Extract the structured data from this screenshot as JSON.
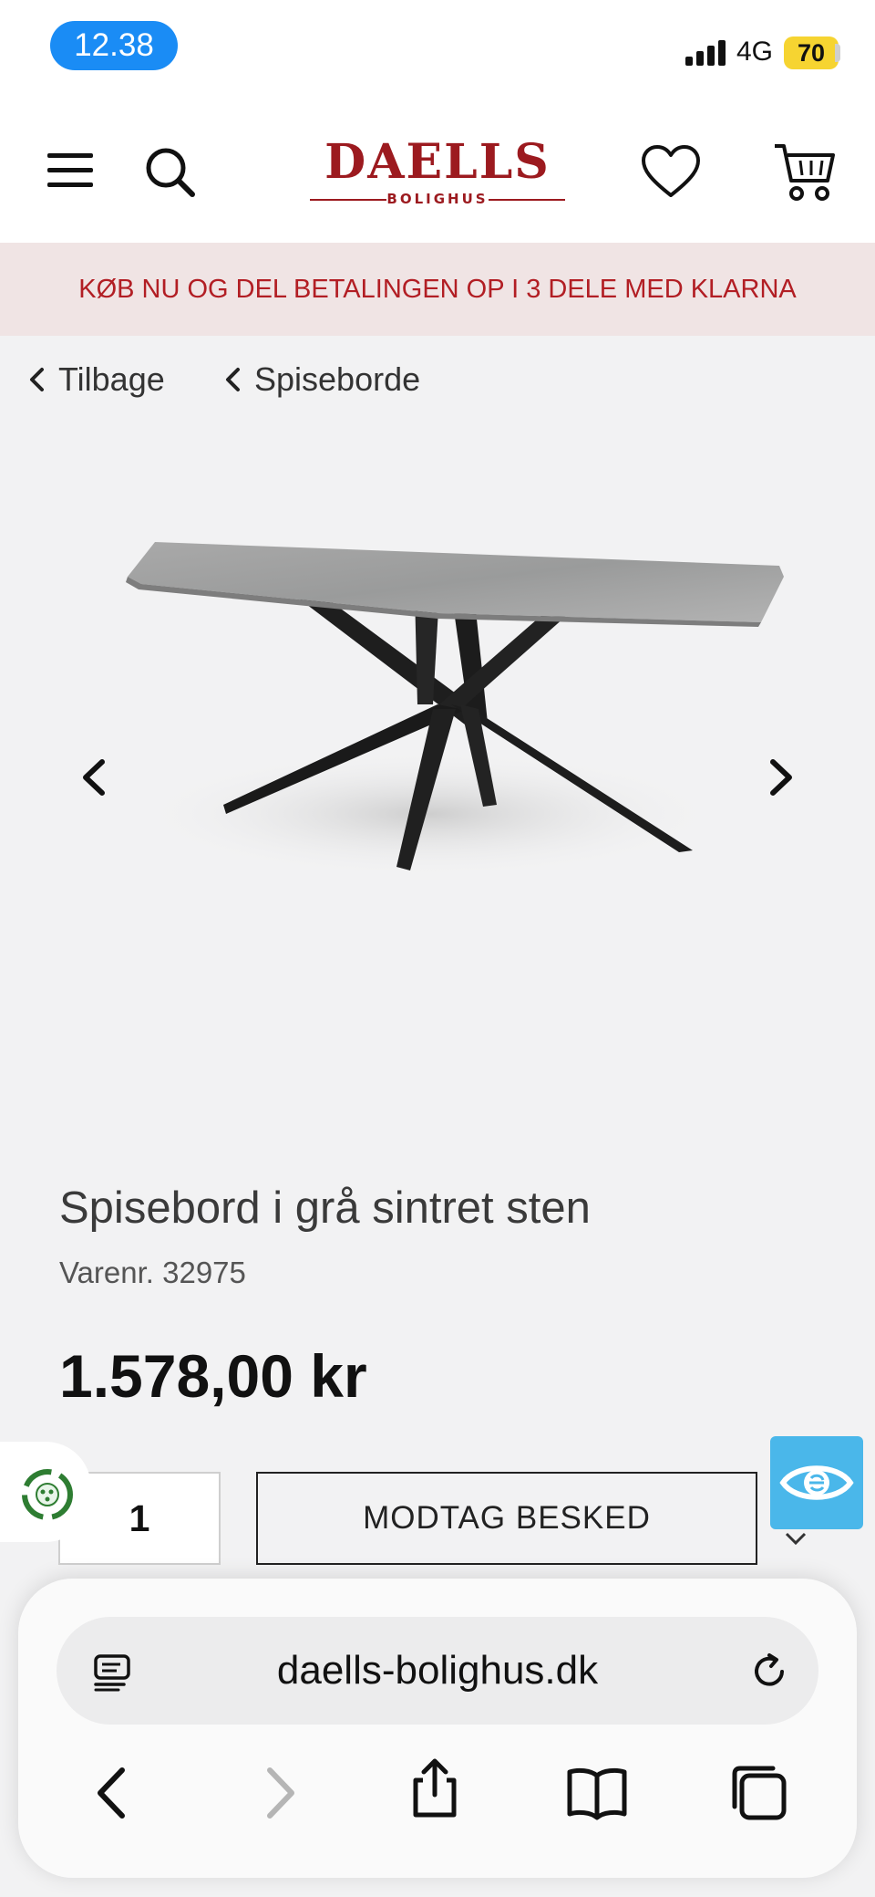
{
  "status_bar": {
    "time": "12.38",
    "network": "4G",
    "battery": "70"
  },
  "header": {
    "logo_main": "DAELLS",
    "logo_sub": "BOLIGHUS",
    "menu_icon": "hamburger-icon",
    "search_icon": "search-icon",
    "wishlist_icon": "heart-icon",
    "cart_icon": "cart-icon",
    "brand_color": "#9c1a1f"
  },
  "banner": {
    "text": "KØB NU OG DEL BETALINGEN OP I 3 DELE MED KLARNA",
    "color": "#b21e24"
  },
  "breadcrumbs": [
    {
      "label": "Tilbage"
    },
    {
      "label": "Spiseborde"
    }
  ],
  "product": {
    "title": "Spisebord i grå sintret sten",
    "sku": "Varenr. 32975",
    "price": "1.578,00 kr",
    "quantity": "1",
    "notify_button": "MODTAG BESKED"
  },
  "safari": {
    "url": "daells-bolighus.dk",
    "icons": [
      "reader-icon",
      "reload-icon",
      "back-icon",
      "forward-icon",
      "share-icon",
      "bookmarks-icon",
      "tabs-icon"
    ]
  }
}
